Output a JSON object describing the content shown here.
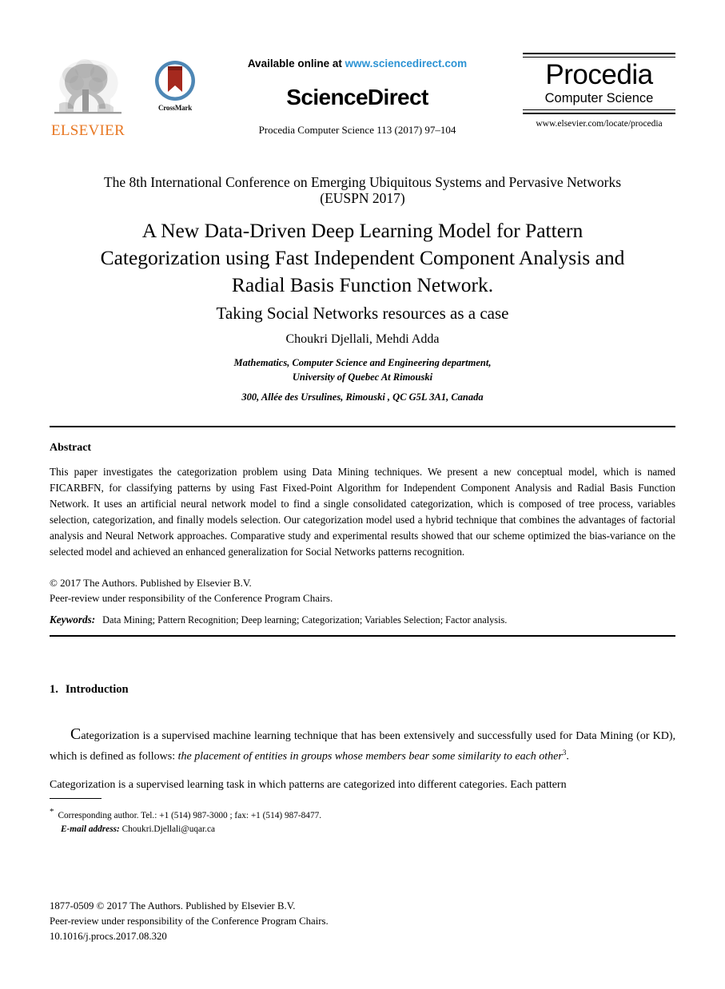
{
  "header": {
    "elsevier_logo_word": "ELSEVIER",
    "crossmark_label": "CrossMark",
    "available_prefix": "Available online at ",
    "available_url": "www.sciencedirect.com",
    "sciencedirect_wordmark": "ScienceDirect",
    "journal_reference": "Procedia Computer Science 113 (2017) 97–104",
    "procedia_title": "Procedia",
    "procedia_subtitle": "Computer Science",
    "procedia_url": "www.elsevier.com/locate/procedia"
  },
  "conference": {
    "line1": "The 8th International Conference on Emerging Ubiquitous Systems and Pervasive Networks",
    "line2": "(EUSPN 2017)"
  },
  "title": {
    "line1": "A New Data-Driven Deep Learning Model for Pattern",
    "line2": "Categorization using Fast Independent Component Analysis and",
    "line3": "Radial Basis Function Network.",
    "line4": "Taking Social Networks resources as a case"
  },
  "authors": {
    "names": "Choukri Djellali, Mehdi Adda",
    "affiliation_line1": "Mathematics, Computer Science and Engineering department,",
    "affiliation_line2": "University of Quebec At Rimouski",
    "address": "300, Allée des Ursulines, Rimouski , QC G5L 3A1, Canada"
  },
  "abstract": {
    "heading": "Abstract",
    "body": "This paper investigates the categorization problem using Data Mining techniques. We present a new conceptual model, which is named FICARBFN, for classifying patterns by using Fast Fixed-Point Algorithm for Independent Component Analysis and Radial Basis Function Network. It uses an artificial neural network model to find a single consolidated categorization, which is composed of tree process, variables selection, categorization, and finally models selection. Our categorization model used a hybrid technique that combines the advantages of factorial analysis and Neural Network approaches. Comparative study and experimental results showed that our scheme optimized the bias-variance on the selected model and achieved an enhanced generalization for Social Networks patterns recognition.",
    "copyright_line1": "© 2017 The Authors. Published by Elsevier B.V.",
    "copyright_line2": "Peer-review under responsibility of the Conference Program Chairs.",
    "keywords_label": "Keywords:",
    "keywords_value": "Data Mining; Pattern Recognition; Deep learning; Categorization; Variables Selection; Factor analysis."
  },
  "introduction": {
    "number": "1.",
    "heading": "Introduction",
    "dropcap": "C",
    "paragraph1_a": "ategorization is a supervised machine learning technique that has been extensively and successfully used for Data Mining (or KD), which is defined as follows: ",
    "paragraph1_italic": "the placement of entities in groups whose members bear some similarity to each other",
    "paragraph1_sup": "3",
    "paragraph1_end": ".",
    "paragraph2": "Categorization is a supervised learning task in which patterns are categorized into different categories. Each pattern"
  },
  "footnote": {
    "marker": "*",
    "corresponding": "Corresponding author. Tel.: +1 (514) 987-3000 ; fax: +1 (514) 987-8477.",
    "email_label": "E-mail address:",
    "email_value": "Choukri.Djellali@uqar.ca"
  },
  "publisher_footer": {
    "line1": "1877-0509 © 2017 The Authors. Published by Elsevier B.V.",
    "line2": "Peer-review under responsibility of the Conference Program Chairs.",
    "line3": "10.1016/j.procs.2017.08.320"
  },
  "colors": {
    "elsevier_orange": "#E87722",
    "sciencedirect_link_blue": "#2C93D4",
    "crossmark_ring_blue": "#4E87B5",
    "crossmark_ribbon_red": "#A5291E",
    "tree_grey": "#8C8C8C"
  }
}
